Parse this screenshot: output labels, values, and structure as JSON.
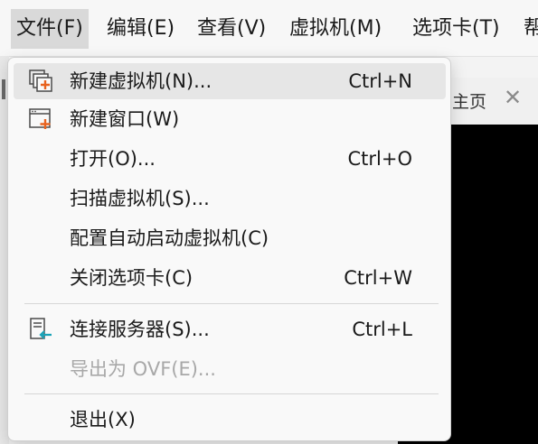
{
  "menubar": {
    "items": [
      {
        "label": "文件(F)",
        "active": true
      },
      {
        "label": "编辑(E)"
      },
      {
        "label": "查看(V)"
      },
      {
        "label": "虚拟机(M)"
      },
      {
        "label": "选项卡(T)"
      },
      {
        "label": "帮"
      }
    ]
  },
  "background": {
    "tab_label": "主页",
    "tab_close": "✕"
  },
  "file_menu": {
    "items": [
      {
        "label": "新建虚拟机(N)...",
        "shortcut": "Ctrl+N",
        "icon": "new-vm-icon",
        "highlighted": true
      },
      {
        "label": "新建窗口(W)",
        "shortcut": "",
        "icon": "new-window-icon"
      },
      {
        "label": "打开(O)...",
        "shortcut": "Ctrl+O"
      },
      {
        "label": "扫描虚拟机(S)..."
      },
      {
        "label": "配置自动启动虚拟机(C)"
      },
      {
        "label": "关闭选项卡(C)",
        "shortcut": "Ctrl+W"
      },
      {
        "label": "连接服务器(S)...",
        "shortcut": "Ctrl+L",
        "icon": "connect-server-icon"
      },
      {
        "label": "导出为 OVF(E)...",
        "disabled": true
      },
      {
        "label": "退出(X)"
      }
    ]
  },
  "colors": {
    "accent_orange": "#e8621f",
    "accent_teal": "#1aa3b8",
    "hover_bg": "#e6e6e6"
  }
}
